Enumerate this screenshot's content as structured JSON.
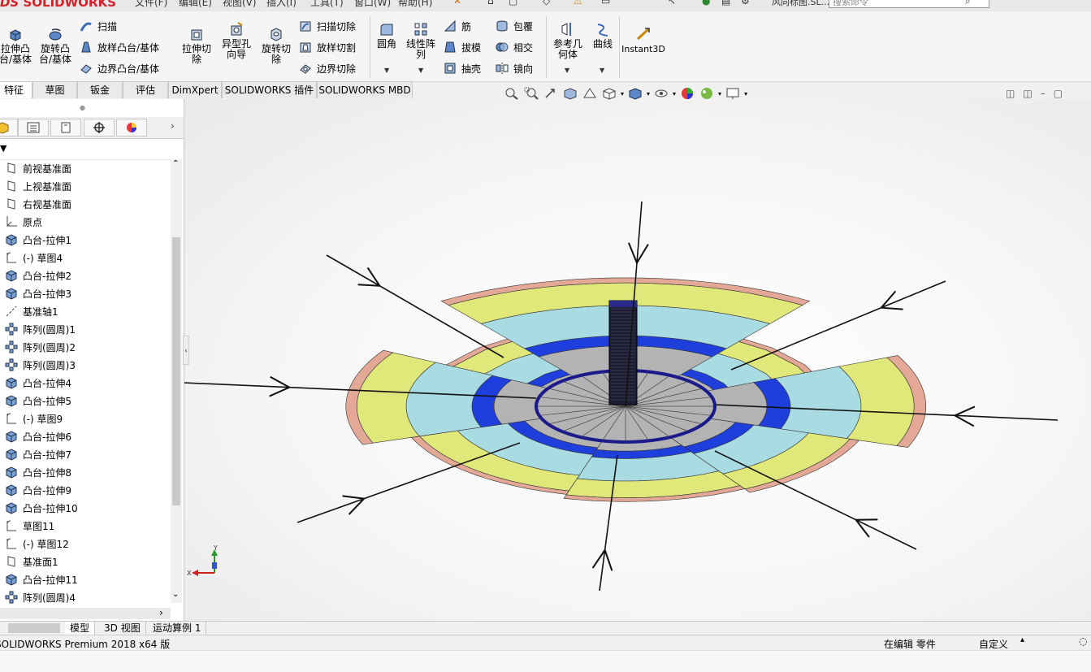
{
  "app": {
    "logo_text": "SOLIDWORKS",
    "menu": [
      "文件(F)",
      "编辑(E)",
      "视图(V)",
      "插入(I)",
      "工具(T)",
      "窗口(W)",
      "帮助(H)"
    ],
    "doc_title": "风向标图.SL...",
    "search_placeholder": "搜索命令"
  },
  "ribbon": {
    "extrude_boss": "拉伸凸台/基体",
    "revolve_boss": "旋转凸台/基体",
    "sweep": "扫描",
    "loft_boss": "放样凸台/基体",
    "boundary_boss": "边界凸台/基体",
    "extrude_cut": "拉伸切除",
    "hole_wizard": "异型孔向导",
    "revolve_cut": "旋转切除",
    "sweep_cut": "扫描切除",
    "loft_cut": "放样切割",
    "boundary_cut": "边界切除",
    "fillet": "圆角",
    "linear_pattern": "线性阵列",
    "rib": "筋",
    "draft": "拔模",
    "shell": "抽壳",
    "wrap": "包覆",
    "intersect": "相交",
    "mirror": "镜向",
    "ref_geometry": "参考几何体",
    "curves": "曲线",
    "instant3d": "Instant3D"
  },
  "tabs": [
    "特征",
    "草图",
    "钣金",
    "评估",
    "DimXpert",
    "SOLIDWORKS 插件",
    "SOLIDWORKS MBD"
  ],
  "feature_tree": [
    {
      "label": "前视基准面",
      "icon": "plane-icon"
    },
    {
      "label": "上视基准面",
      "icon": "plane-icon"
    },
    {
      "label": "右视基准面",
      "icon": "plane-icon"
    },
    {
      "label": "原点",
      "icon": "origin-icon"
    },
    {
      "label": "凸台-拉伸1",
      "icon": "extrude-icon"
    },
    {
      "label": "(-) 草图4",
      "icon": "sketch-icon"
    },
    {
      "label": "凸台-拉伸2",
      "icon": "extrude-icon"
    },
    {
      "label": "凸台-拉伸3",
      "icon": "extrude-icon"
    },
    {
      "label": "基准轴1",
      "icon": "axis-icon"
    },
    {
      "label": "阵列(圆周)1",
      "icon": "pattern-icon"
    },
    {
      "label": "阵列(圆周)2",
      "icon": "pattern-icon"
    },
    {
      "label": "阵列(圆周)3",
      "icon": "pattern-icon"
    },
    {
      "label": "凸台-拉伸4",
      "icon": "extrude-icon"
    },
    {
      "label": "凸台-拉伸5",
      "icon": "extrude-icon"
    },
    {
      "label": "(-) 草图9",
      "icon": "sketch-icon"
    },
    {
      "label": "凸台-拉伸6",
      "icon": "extrude-icon"
    },
    {
      "label": "凸台-拉伸7",
      "icon": "extrude-icon"
    },
    {
      "label": "凸台-拉伸8",
      "icon": "extrude-icon"
    },
    {
      "label": "凸台-拉伸9",
      "icon": "extrude-icon"
    },
    {
      "label": "凸台-拉伸10",
      "icon": "extrude-icon"
    },
    {
      "label": "草图11",
      "icon": "sketch-icon"
    },
    {
      "label": "(-) 草图12",
      "icon": "sketch-icon"
    },
    {
      "label": "基准面1",
      "icon": "plane-icon"
    },
    {
      "label": "凸台-拉伸11",
      "icon": "extrude-icon"
    },
    {
      "label": "阵列(圆周)4",
      "icon": "pattern-icon"
    }
  ],
  "triad": {
    "x": "X",
    "y": "Y"
  },
  "bottom_tabs": [
    "模型",
    "3D 视图",
    "运动算例 1"
  ],
  "status": {
    "version": "SOLIDWORKS Premium 2018 x64 版",
    "mode": "在编辑 零件",
    "units": "自定义"
  },
  "colors": {
    "yellow": "#e0e87a",
    "light_blue": "#a9dce2",
    "blue": "#1f3fdc",
    "navy": "#1a1a8a",
    "gray": "#b3b3b3",
    "salmon": "#e3a996"
  }
}
